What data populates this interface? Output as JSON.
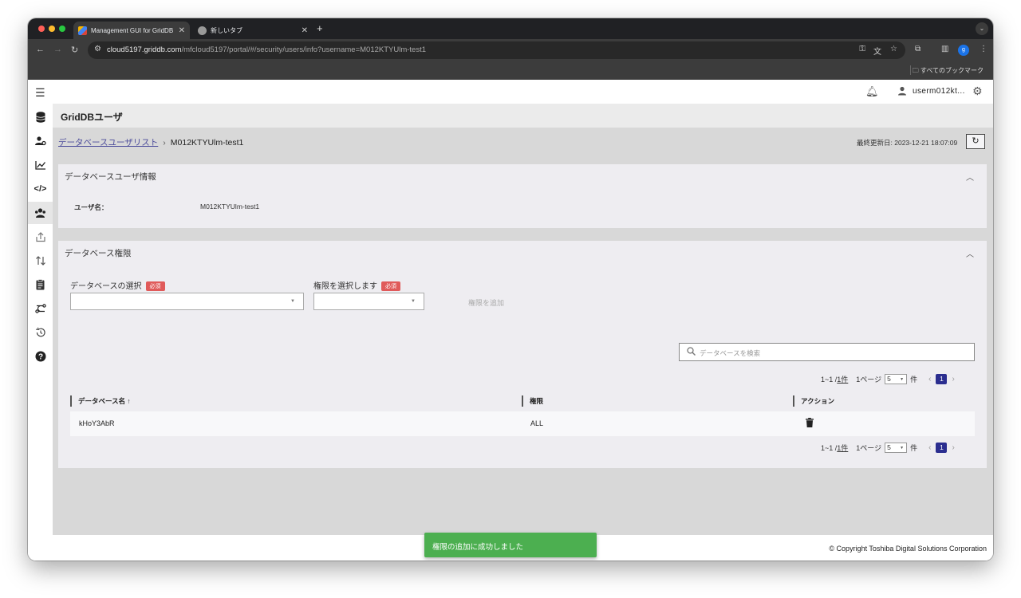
{
  "browser": {
    "tabs": [
      {
        "title": "Management GUI for GridDB",
        "active": true
      },
      {
        "title": "新しいタブ",
        "active": false
      }
    ],
    "new_tab_label": "+",
    "url_host": "cloud5197.griddb.com",
    "url_path": "/mfcloud5197/portal/#/security/users/info?username=M012KTYUlm-test1",
    "bookmarks_label": "すべてのブックマーク",
    "profile_initial": "g"
  },
  "app": {
    "username": "userm012kt...",
    "page_title": "GridDBユーザ",
    "breadcrumb": {
      "parent": "データベースユーザリスト",
      "current": "M012KTYUlm-test1"
    },
    "last_updated_label": "最終更新日:",
    "last_updated_value": "2023-12-21 18:07:09",
    "user_info": {
      "header": "データベースユーザ情報",
      "username_label": "ユーザ名：",
      "username_value": "M012KTYUlm-test1"
    },
    "permissions": {
      "header": "データベース権限",
      "db_select_label": "データベースの選択",
      "perm_select_label": "権限を選択します",
      "required_badge": "必須",
      "add_button": "権限を追加",
      "search_placeholder": "データベースを検索",
      "pager": {
        "range": "1~1 / ",
        "total": "1件",
        "per_page_label": "1ページ",
        "per_page_value": "5",
        "unit": "件",
        "current_page": "1"
      },
      "columns": [
        "データベース名 ↑",
        "権限",
        "アクション"
      ],
      "rows": [
        {
          "database": "kHoY3AbR",
          "permission": "ALL"
        }
      ]
    },
    "copyright": "© Copyright Toshiba Digital Solutions Corporation",
    "toast": "権限の追加に成功しました"
  },
  "colors": {
    "accent": "#2b2e8f",
    "required": "#e05a5a",
    "toast": "#4caf50"
  }
}
